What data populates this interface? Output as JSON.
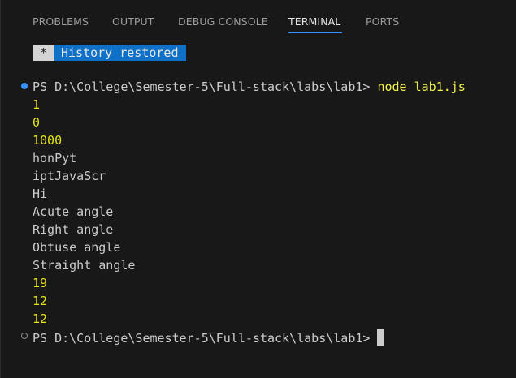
{
  "tabs": [
    {
      "label": "PROBLEMS"
    },
    {
      "label": "OUTPUT"
    },
    {
      "label": "DEBUG CONSOLE"
    },
    {
      "label": "TERMINAL",
      "active": true
    },
    {
      "label": "PORTS"
    }
  ],
  "banner": {
    "marker": "*",
    "text": "History restored"
  },
  "terminal": {
    "prompt": "PS D:\\College\\Semester-5\\Full-stack\\labs\\lab1> ",
    "command": "node lab1.js",
    "output": [
      "1",
      "0",
      "1000",
      "honPyt",
      "iptJavaScr",
      "Hi",
      "Acute angle",
      "Right angle",
      "Obtuse angle",
      "Straight angle",
      "19",
      "12",
      "12"
    ],
    "prompt2": "PS D:\\College\\Semester-5\\Full-stack\\labs\\lab1> "
  },
  "colors": {
    "background": "#181818",
    "accent": "#3794ff",
    "number_output": "#e5e510",
    "text": "#cccccc"
  }
}
